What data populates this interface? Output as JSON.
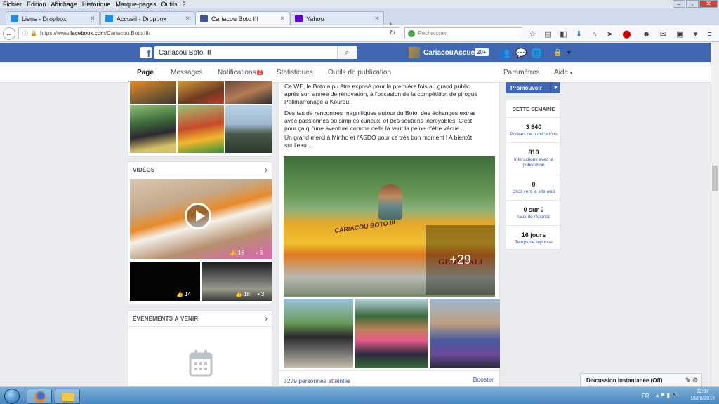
{
  "browser": {
    "menu": [
      "Fichier",
      "Édition",
      "Affichage",
      "Historique",
      "Marque-pages",
      "Outils",
      "?"
    ],
    "tabs": [
      {
        "label": "Liens - Dropbox",
        "active": false
      },
      {
        "label": "Accueil - Dropbox",
        "active": false
      },
      {
        "label": "Cariacou Boto III",
        "active": true
      },
      {
        "label": "Yahoo",
        "active": false
      }
    ],
    "url_prefix": "https://www.",
    "url_host": "facebook.com",
    "url_path": "/Cariacou.Boto.III/",
    "search_placeholder": "Rechercher"
  },
  "fb": {
    "search_value": "Cariacou Boto III",
    "profile_name": "Cariacou",
    "home_label": "Accueil",
    "home_count": "20+"
  },
  "page_nav": {
    "page": "Page",
    "messages": "Messages",
    "notifications": "Notifications",
    "notifications_count": "2",
    "stats": "Statistiques",
    "publishing_tools": "Outils de publication",
    "settings": "Paramètres",
    "help": "Aide"
  },
  "left": {
    "videos_title": "VIDÉOS",
    "video_main_likes": "16",
    "video_main_comments": "3",
    "video_a_likes": "14",
    "video_b_likes": "18",
    "video_b_comments": "3",
    "events_title": "ÉVÉNEMENTS À VENIR"
  },
  "post": {
    "lines": [
      "Ce WE, le Boto a pu être exposé pour la première fois au grand public",
      "après son année de rénovation, à l'occasion de la compétition de pirogue",
      "Palimarronage à Kourou.",
      "Des tas de rencontres magnifiques autour du Boto, des échanges extras",
      "avec passionnés ou simples curieux, et des soutiens incroyables. C'est",
      "pour ça qu'une aventure comme celle là vaut la peine d'être vécue...",
      "Un grand merci à Mirtho et l'ASDO pour ce très bon moment ! A bientôt",
      "sur l'eau..."
    ],
    "boat_name": "CARIACOU BOTO III",
    "sponsor": "GENERALI",
    "more_photos": "+29",
    "reach": "3279 personnes atteintes",
    "boost": "Booster"
  },
  "right": {
    "promote": "Promouvoir",
    "week_title": "CETTE SEMAINE",
    "stats": [
      {
        "value": "3 840",
        "label": "Portées de publications"
      },
      {
        "value": "810",
        "label": "Interactions avec la publication"
      },
      {
        "value": "0",
        "label": "Clics vers le site web"
      },
      {
        "value": "0 sur 0",
        "label": "Taux de réponse"
      },
      {
        "value": "16 jours",
        "label": "Temps de réponse"
      }
    ]
  },
  "chat": {
    "label": "Discussion instantanée (Off)"
  },
  "taskbar": {
    "lang": "FR",
    "time": "22:07",
    "date": "16/06/2016"
  },
  "colors": {
    "fb_blue": "#4267b2",
    "link": "#365899",
    "badge": "#fa3e3e"
  }
}
